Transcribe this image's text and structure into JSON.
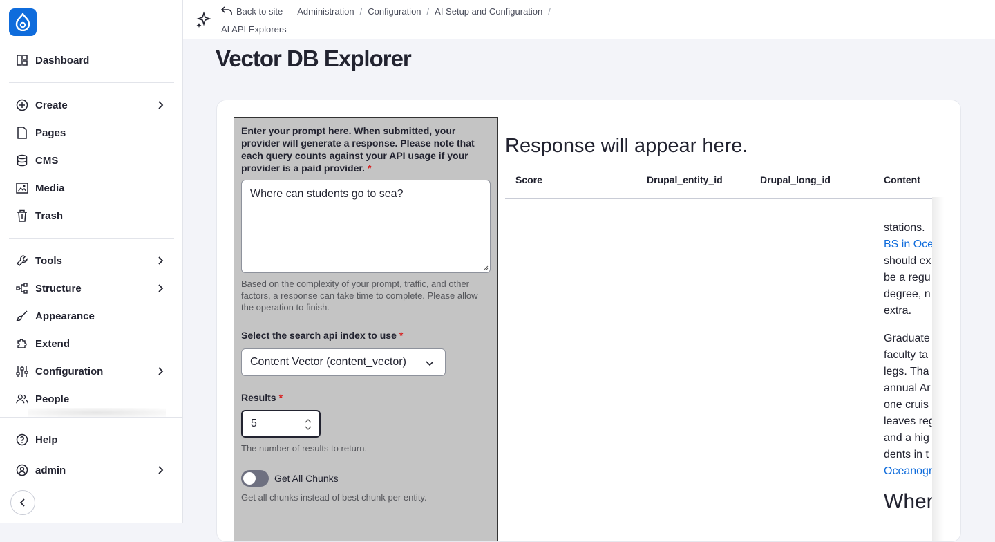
{
  "sidebar": {
    "items": [
      {
        "label": "Dashboard",
        "icon": "dashboard-icon"
      },
      {
        "label": "Create",
        "icon": "plus-circle-icon"
      },
      {
        "label": "Pages",
        "icon": "page-icon"
      },
      {
        "label": "CMS",
        "icon": "database-icon"
      },
      {
        "label": "Media",
        "icon": "media-icon"
      },
      {
        "label": "Trash",
        "icon": "trash-icon"
      },
      {
        "label": "Tools",
        "icon": "wrench-icon"
      },
      {
        "label": "Structure",
        "icon": "structure-icon"
      },
      {
        "label": "Appearance",
        "icon": "brush-icon"
      },
      {
        "label": "Extend",
        "icon": "puzzle-icon"
      },
      {
        "label": "Configuration",
        "icon": "sliders-icon"
      },
      {
        "label": "People",
        "icon": "people-icon"
      }
    ],
    "help": "Help",
    "user": "admin"
  },
  "breadcrumb": {
    "back": "Back to site",
    "items": [
      "Administration",
      "Configuration",
      "AI Setup and Configuration",
      "AI API Explorers"
    ]
  },
  "page": {
    "title": "Vector DB Explorer"
  },
  "form": {
    "prompt_label": "Enter your prompt here. When submitted, your provider will generate a response. Please note that each query counts against your API usage if your provider is a paid provider.",
    "required_mark": "*",
    "prompt_value": "Where can students go to sea?",
    "prompt_help": "Based on the complexity of your prompt, traffic, and other factors, a response can take time to complete. Please allow the operation to finish.",
    "index_label": "Select the search api index to use",
    "index_value": "Content Vector (content_vector)",
    "results_label": "Results",
    "results_value": "5",
    "results_help": "The number of results to return.",
    "chunks_label": "Get All Chunks",
    "chunks_help": "Get all chunks instead of best chunk per entity."
  },
  "response": {
    "heading": "Response will appear here.",
    "columns": [
      "Score",
      "Drupal_entity_id",
      "Drupal_long_id",
      "Content"
    ],
    "content_lines": [
      {
        "text": "stations.",
        "link": false
      },
      {
        "text": "BS in Oce",
        "link": true
      },
      {
        "text": "should ex",
        "link": false
      },
      {
        "text": "be a regu",
        "link": false
      },
      {
        "text": "degree, n",
        "link": false
      },
      {
        "text": "extra.",
        "link": false
      }
    ],
    "content_lines_2": [
      {
        "text": "Graduate",
        "link": false
      },
      {
        "text": "faculty ta",
        "link": false
      },
      {
        "text": "legs. Tha",
        "link": false
      },
      {
        "text": "annual Ar",
        "link": false
      },
      {
        "text": "one cruis",
        "link": false
      },
      {
        "text": "leaves reg",
        "link": false
      },
      {
        "text": "and a hig",
        "link": false
      },
      {
        "text": "dents in t",
        "link": false
      },
      {
        "text": "Oceanogr",
        "link": true
      }
    ],
    "content_heading": "When"
  }
}
